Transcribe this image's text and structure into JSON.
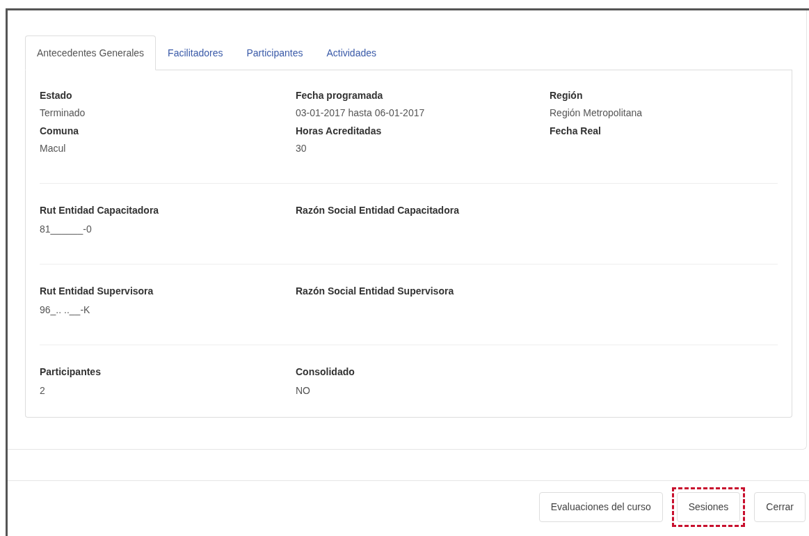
{
  "tabs": [
    {
      "label": "Antecedentes Generales",
      "selected": true
    },
    {
      "label": "Facilitadores",
      "selected": false
    },
    {
      "label": "Participantes",
      "selected": false
    },
    {
      "label": "Actividades",
      "selected": false
    }
  ],
  "sections": [
    {
      "fields": [
        {
          "label": "Estado",
          "value": "Terminado"
        },
        {
          "label": "Fecha programada",
          "value": "03-01-2017 hasta 06-01-2017"
        },
        {
          "label": "Región",
          "value": "Región Metropolitana"
        },
        {
          "label": "Comuna",
          "value": "Macul"
        },
        {
          "label": "Horas Acreditadas",
          "value": "30"
        },
        {
          "label": "Fecha Real"
        }
      ]
    },
    {
      "fields": [
        {
          "label": "Rut Entidad Capacitadora",
          "value": "81______-0"
        },
        {
          "label": "Razón Social Entidad Capacitadora"
        }
      ]
    },
    {
      "fields": [
        {
          "label": "Rut Entidad Supervisora",
          "value": "96_.. ..__-K"
        },
        {
          "label": "Razón Social Entidad Supervisora"
        }
      ]
    },
    {
      "fields": [
        {
          "label": "Participantes",
          "value": "2"
        },
        {
          "label": "Consolidado",
          "value": "NO"
        }
      ]
    }
  ],
  "buttons": [
    {
      "label": "Evaluaciones del curso",
      "highlighted": false
    },
    {
      "label": "Sesiones",
      "highlighted": true
    },
    {
      "label": "Cerrar",
      "highlighted": false
    }
  ]
}
